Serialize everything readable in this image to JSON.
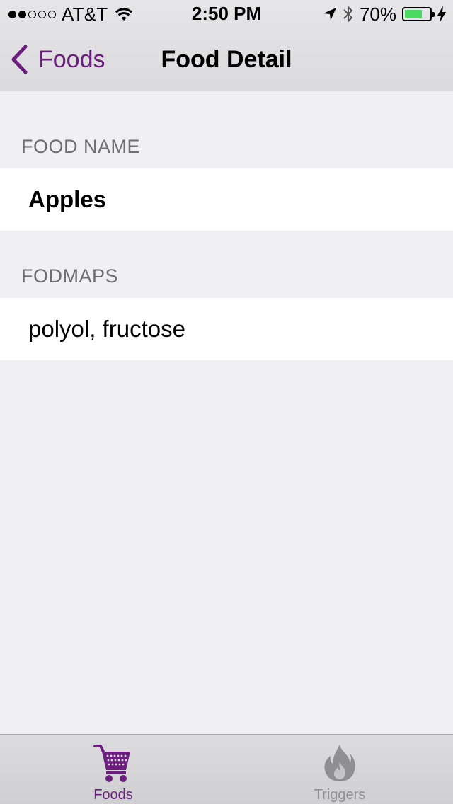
{
  "status_bar": {
    "carrier": "AT&T",
    "time": "2:50 PM",
    "battery_percent": "70%",
    "battery_level": 0.7,
    "signal_strength_dots": 2,
    "icons": [
      "wifi-icon",
      "location-arrow-icon",
      "bluetooth-icon",
      "battery-icon",
      "charging-bolt-icon"
    ]
  },
  "nav": {
    "back_label": "Foods",
    "title": "Food Detail",
    "accent_color": "#6b1e7d"
  },
  "sections": [
    {
      "header": "FOOD NAME",
      "value": "Apples"
    },
    {
      "header": "FODMAPS",
      "value": "polyol, fructose"
    }
  ],
  "tab_bar": {
    "tabs": [
      {
        "label": "Foods",
        "icon": "shopping-cart-icon",
        "active": true
      },
      {
        "label": "Triggers",
        "icon": "flame-icon",
        "active": false
      }
    ]
  }
}
